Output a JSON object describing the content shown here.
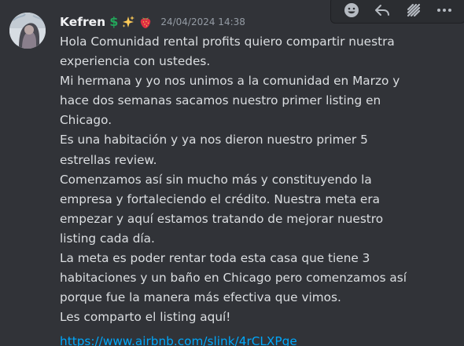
{
  "message": {
    "author": {
      "name": "Kefren",
      "role_icons": [
        "dollar-icon",
        "sparkles-icon",
        "strawberry-icon"
      ],
      "dollar_glyph": "$",
      "avatar": "user-avatar"
    },
    "timestamp": "24/04/2024 14:38",
    "lines": [
      "Hola Comunidad  rental profits  quiero compartir nuestra",
      "experiencia con ustedes.",
      "Mi hermana y yo nos unimos a la comunidad en Marzo y",
      "hace dos semanas sacamos nuestro primer listing en",
      "Chicago.",
      "Es una habitación y ya nos dieron nuestro primer 5",
      "estrellas review.",
      "Comenzamos así sin mucho más y constituyendo la",
      "empresa y fortaleciendo el crédito. Nuestra meta era",
      "empezar y aquí estamos tratando de mejorar nuestro",
      "listing cada día.",
      "La meta es poder rentar toda esta casa que tiene 3",
      "habitaciones y un baño en Chicago pero comenzamos así",
      "porque fue la manera más efectiva que vimos.",
      "Les comparto el listing aquí!"
    ],
    "link": {
      "text": "https://www.airbnb.com/slink/4rCLXPge",
      "href": "https://www.airbnb.com/slink/4rCLXPge"
    }
  },
  "toolbar": {
    "icons": [
      "add-reaction-icon",
      "reply-icon",
      "create-thread-icon",
      "more-options-icon"
    ]
  },
  "colors": {
    "background": "#313338",
    "username": "#f2f3f5",
    "text": "#dbdee1",
    "timestamp": "#949ba4",
    "link": "#00a8fc",
    "dollar": "#23a55a",
    "toolbar_bg": "#2b2d31"
  }
}
